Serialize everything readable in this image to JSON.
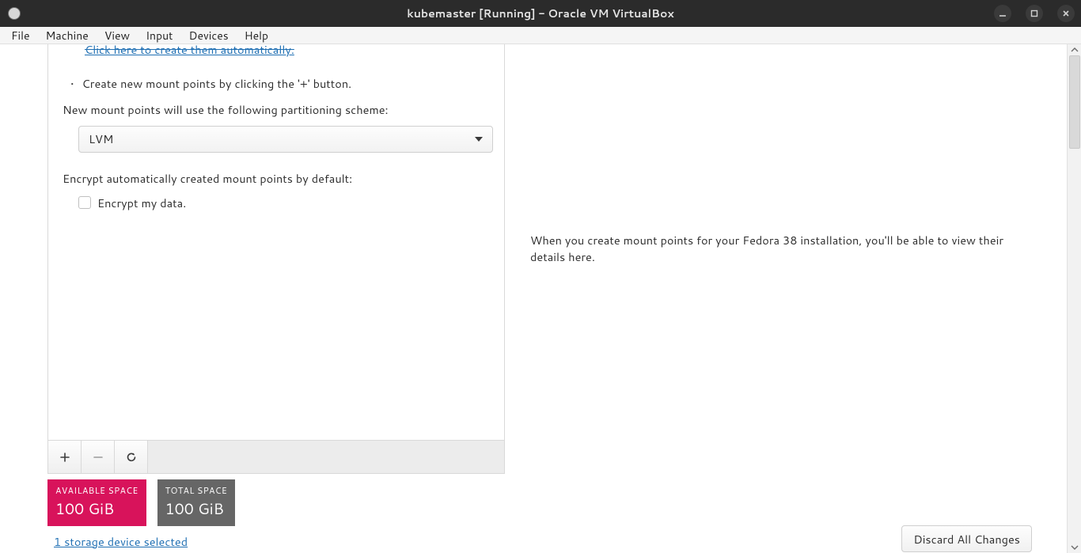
{
  "window": {
    "title": "kubemaster [Running] - Oracle VM VirtualBox"
  },
  "menubar": {
    "file": "File",
    "machine": "Machine",
    "view": "View",
    "input": "Input",
    "devices": "Devices",
    "help": "Help"
  },
  "left": {
    "auto_link": "Click here to create them automatically.",
    "bullet": "Create new mount points by clicking the '+' button.",
    "scheme_label": "New mount points will use the following partitioning scheme:",
    "scheme_value": "LVM",
    "encrypt_label": "Encrypt automatically created mount points by default:",
    "encrypt_checkbox_label": "Encrypt my data."
  },
  "right": {
    "detail_text": "When you create mount points for your Fedora 38 installation, you'll be able to view their details here."
  },
  "space": {
    "available_label": "AVAILABLE SPACE",
    "available_value": "100 GiB",
    "total_label": "TOTAL SPACE",
    "total_value": "100 GiB"
  },
  "storage_link": "1 storage device selected",
  "discard_label": "Discard All Changes"
}
